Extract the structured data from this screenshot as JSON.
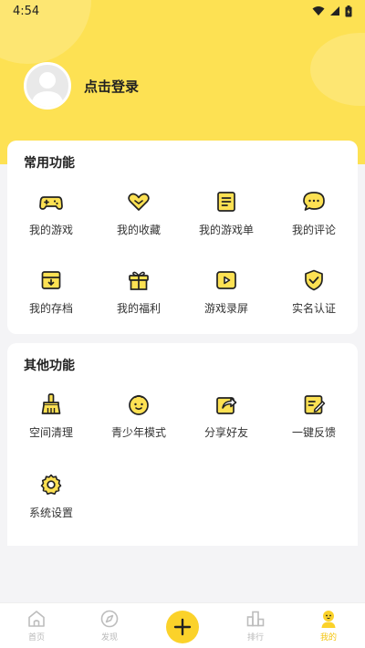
{
  "status_bar": {
    "time": "4:54"
  },
  "profile": {
    "login_label": "点击登录"
  },
  "common_functions": {
    "title": "常用功能",
    "items": [
      {
        "label": "我的游戏",
        "icon": "gamepad-icon"
      },
      {
        "label": "我的收藏",
        "icon": "heart-icon"
      },
      {
        "label": "我的游戏单",
        "icon": "list-icon"
      },
      {
        "label": "我的评论",
        "icon": "comment-icon"
      },
      {
        "label": "我的存档",
        "icon": "archive-icon"
      },
      {
        "label": "我的福利",
        "icon": "gift-icon"
      },
      {
        "label": "游戏录屏",
        "icon": "video-icon"
      },
      {
        "label": "实名认证",
        "icon": "shield-check-icon"
      }
    ]
  },
  "other_functions": {
    "title": "其他功能",
    "items": [
      {
        "label": "空间清理",
        "icon": "broom-icon"
      },
      {
        "label": "青少年模式",
        "icon": "child-face-icon"
      },
      {
        "label": "分享好友",
        "icon": "share-icon"
      },
      {
        "label": "一键反馈",
        "icon": "feedback-icon"
      },
      {
        "label": "系统设置",
        "icon": "gear-icon"
      }
    ]
  },
  "tabbar": {
    "items": [
      {
        "label": "首页",
        "icon": "home-icon"
      },
      {
        "label": "发现",
        "icon": "compass-icon"
      },
      {
        "label": "",
        "icon": "plus-icon"
      },
      {
        "label": "排行",
        "icon": "ranking-icon"
      },
      {
        "label": "我的",
        "icon": "user-icon",
        "active": true
      }
    ]
  },
  "colors": {
    "accent": "#fde153",
    "accent_dark": "#f3c40d",
    "background": "#f4f4f6"
  }
}
